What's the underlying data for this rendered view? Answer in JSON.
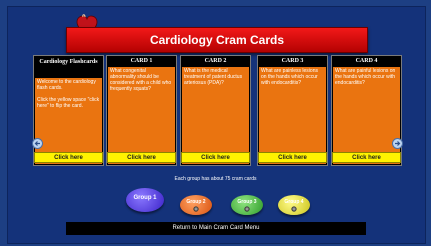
{
  "app": {
    "title": "Cardiology Cram Cards"
  },
  "intro_card": {
    "header": "Cardiology Flashcards",
    "text": "Welcome to the cardiology flash cards.\n\nClick the yellow space \"click here\" to flip the card.",
    "button": "Click here"
  },
  "cards": [
    {
      "header": "CARD 1",
      "text": "What congenital abnormality should be considered with a child who frequently squats?",
      "button": "Click here"
    },
    {
      "header": "CARD 2",
      "text": "What is the medical treatment of patent ductus arteriosus (PDA)?",
      "button": "Click here"
    },
    {
      "header": "CARD 3",
      "text": "What are painless lesions on the hands which occur with endocarditis?",
      "button": "Click here"
    },
    {
      "header": "CARD 4",
      "text": "What are painful lesions on the hands which occur with endocarditis?",
      "button": "Click here"
    }
  ],
  "info": "Each group has about 75 cram cards",
  "groups": [
    {
      "label": "Group 1",
      "color": "#4b2fd6"
    },
    {
      "label": "Group 2",
      "color": "#e8621a"
    },
    {
      "label": "Group 3",
      "color": "#3fb23a"
    },
    {
      "label": "Group 4",
      "color": "#d8d22a"
    }
  ],
  "footer": {
    "menu_button": "Return to Main Cram Card Menu"
  },
  "icons": {
    "logo": "heart-logo",
    "prev": "arrow-left-icon",
    "next": "arrow-right-icon",
    "group": "gear-icon"
  }
}
